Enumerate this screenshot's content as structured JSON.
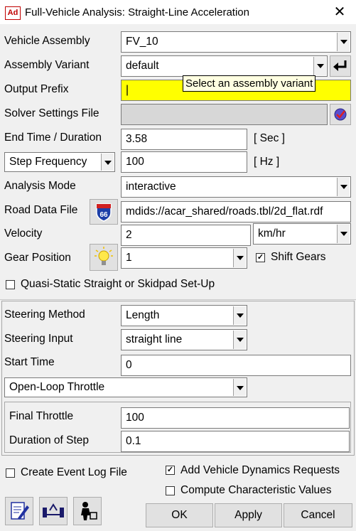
{
  "window": {
    "title": "Full-Vehicle Analysis: Straight-Line Acceleration",
    "app_icon": "Ad",
    "close": "✕"
  },
  "fields": {
    "vehicle_assembly": {
      "label": "Vehicle Assembly",
      "value": "FV_10"
    },
    "assembly_variant": {
      "label": "Assembly Variant",
      "value": "default"
    },
    "output_prefix": {
      "label": "Output Prefix",
      "value": "|"
    },
    "solver_settings": {
      "label": "Solver Settings File",
      "value": ""
    },
    "end_time": {
      "label": "End Time / Duration",
      "value": "3.58",
      "unit": "[ Sec ]"
    },
    "step_frequency": {
      "label": "Step Frequency",
      "value": "100",
      "unit": "[ Hz ]"
    },
    "analysis_mode": {
      "label": "Analysis Mode",
      "value": "interactive"
    },
    "road_data": {
      "label": "Road Data File",
      "value": "mdids://acar_shared/roads.tbl/2d_flat.rdf"
    },
    "velocity": {
      "label": "Velocity",
      "value": "2",
      "unit": "km/hr"
    },
    "gear_position": {
      "label": "Gear Position",
      "value": "1",
      "shift_label": "Shift Gears",
      "shift_checked": true
    },
    "quasi_static": {
      "label": "Quasi-Static Straight or Skidpad Set-Up",
      "checked": false
    },
    "steering_method": {
      "label": "Steering Method",
      "value": "Length"
    },
    "steering_input": {
      "label": "Steering Input",
      "value": "straight line"
    },
    "start_time": {
      "label": "Start Time",
      "value": "0"
    },
    "throttle_mode": {
      "value": "Open-Loop Throttle"
    },
    "final_throttle": {
      "label": "Final Throttle",
      "value": "100"
    },
    "duration_step": {
      "label": "Duration of Step",
      "value": "0.1"
    }
  },
  "tooltip": "Select an assembly variant",
  "options": {
    "event_log": {
      "label": "Create Event Log File",
      "checked": false
    },
    "dynamics_requests": {
      "label": "Add Vehicle Dynamics Requests",
      "checked": true
    },
    "characteristic": {
      "label": "Compute Characteristic Values",
      "checked": false
    }
  },
  "buttons": {
    "ok": "OK",
    "apply": "Apply",
    "cancel": "Cancel"
  },
  "checkmark": "✓"
}
